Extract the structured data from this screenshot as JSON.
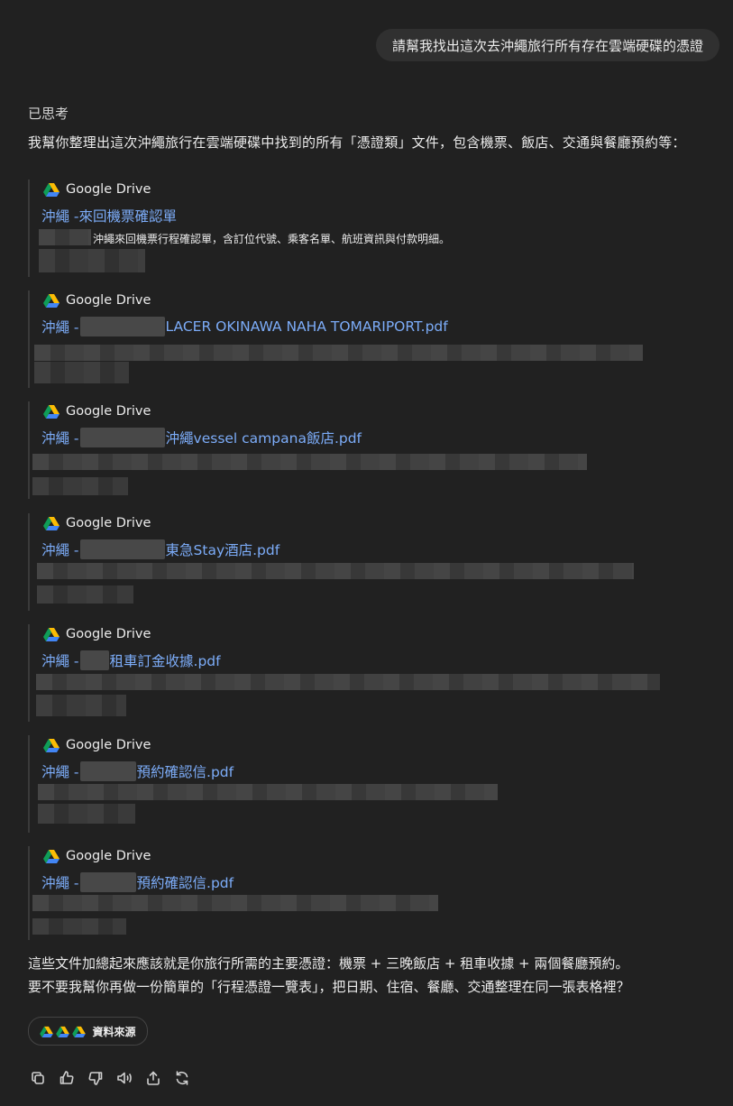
{
  "user_message": "請幫我找出這次去沖繩旅行所有存在雲端硬碟的憑證",
  "thought_label": "已思考",
  "intro": "我幫你整理出這次沖繩旅行在雲端硬碟中找到的所有「憑證類」文件，包含機票、飯店、交通與餐廳預約等：",
  "cards": [
    {
      "source": "Google Drive",
      "title_prefix": "沖繩 -",
      "title_suffix": "來回機票確認單",
      "description": "沖繩來回機票行程確認單，含訂位代號、乘客名單、航班資訊與付款明細。"
    },
    {
      "source": "Google Drive",
      "title_prefix": "沖繩 -",
      "title_suffix": "LACER OKINAWA NAHA TOMARIPORT.pdf"
    },
    {
      "source": "Google Drive",
      "title_prefix": "沖繩 -",
      "title_suffix": "沖繩vessel campana飯店.pdf"
    },
    {
      "source": "Google Drive",
      "title_prefix": "沖繩 -",
      "title_suffix": "東急Stay酒店.pdf"
    },
    {
      "source": "Google Drive",
      "title_prefix": "沖繩 -",
      "title_suffix": "租車訂金收據.pdf"
    },
    {
      "source": "Google Drive",
      "title_prefix": "沖繩 -",
      "title_suffix": "預約確認信.pdf"
    },
    {
      "source": "Google Drive",
      "title_prefix": "沖繩 -",
      "title_suffix": "預約確認信.pdf"
    }
  ],
  "summary_line1": "這些文件加總起來應該就是你旅行所需的主要憑證：機票 + 三晚飯店 + 租車收據 + 兩個餐廳預約。",
  "summary_line2": "要不要我幫你再做一份簡單的「行程憑證一覽表」，把日期、住宿、餐廳、交通整理在同一張表格裡？",
  "sources_label": "資料來源",
  "actions": [
    "copy-icon",
    "thumbs-up-icon",
    "thumbs-down-icon",
    "read-aloud-icon",
    "share-icon",
    "regenerate-icon"
  ],
  "colors": {
    "background": "#212121",
    "link": "#7cacf8",
    "bubble": "#303030"
  }
}
